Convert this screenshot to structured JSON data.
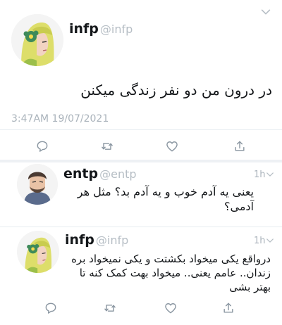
{
  "main_tweet": {
    "name": "infp",
    "handle": "@infp",
    "text": "در درون من دو نفر زندگی میکنن",
    "timestamp": "3:47AM 19/07/2021"
  },
  "reply1": {
    "name": "entp",
    "handle": "@entp",
    "age": "1h",
    "text": "یعنی یه آدم خوب و یه آدم بد؟ مثل هر آدمی؟"
  },
  "reply2": {
    "name": "infp",
    "handle": "@infp",
    "age": "1h",
    "text": "درواقع یکی میخواد بکشتت و یکی نمیخواد بره زندان.. عامم یعنی.. میخواد بهت کمک کنه تا بهتر بشی"
  },
  "icons": {
    "reply": "reply-icon",
    "retweet": "retweet-icon",
    "like": "heart-icon",
    "share": "share-icon",
    "more": "chevron-down-icon"
  },
  "colors": {
    "icon": "#8a96a1",
    "handle": "#b6bec5",
    "divider": "#e6ecf0"
  }
}
